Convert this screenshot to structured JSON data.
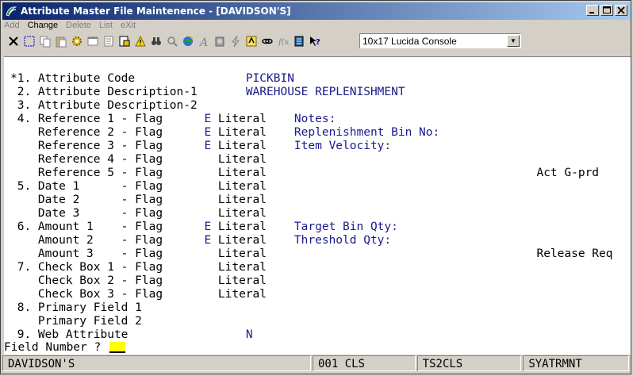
{
  "window": {
    "title": "Attribute Master File Maintenence - [DAVIDSON'S]",
    "minimize": "_",
    "maximize": "□",
    "close": "×"
  },
  "menu": {
    "items": [
      {
        "label": "Add",
        "enabled": false
      },
      {
        "label": "Change",
        "enabled": true
      },
      {
        "label": "Delete",
        "enabled": false
      },
      {
        "label": "List",
        "enabled": false
      },
      {
        "label": "eXit",
        "enabled": false
      }
    ]
  },
  "toolbar": {
    "font_selector_value": "10x17 Lucida Console",
    "icons": [
      "close-x-icon",
      "select-icon",
      "copy-icon",
      "paste-icon",
      "gear-icon",
      "window-icon",
      "list-icon",
      "print-preview-icon",
      "warning-icon",
      "binoculars-icon",
      "magnifier-icon",
      "globe-icon",
      "font-a-icon",
      "phone-icon",
      "lightning-icon",
      "calc-icon",
      "link-icon",
      "function-icon",
      "notes-icon",
      "help-pointer-icon"
    ]
  },
  "screen": {
    "lines": [
      {
        "left": "*1. Attribute Code",
        "right": "PICKBIN"
      },
      {
        "left": " 2. Attribute Description-1",
        "right": "WAREHOUSE REPLENISHMENT"
      },
      {
        "left": " 3. Attribute Description-2",
        "right": ""
      },
      {
        "left": " 4. Reference 1 - Flag",
        "flag": "E",
        "lit": "Literal",
        "note": "Notes:"
      },
      {
        "left": "    Reference 2 - Flag",
        "flag": "E",
        "lit": "Literal",
        "note": "Replenishment Bin No:"
      },
      {
        "left": "    Reference 3 - Flag",
        "flag": "E",
        "lit": "Literal",
        "note": "Item Velocity:"
      },
      {
        "left": "    Reference 4 - Flag",
        "flag": "",
        "lit": "Literal",
        "note": ""
      },
      {
        "left": "    Reference 5 - Flag",
        "flag": "",
        "lit": "Literal",
        "note": "",
        "far": "Act G-prd"
      },
      {
        "left": " 5. Date 1      - Flag",
        "flag": "",
        "lit": "Literal",
        "note": ""
      },
      {
        "left": "    Date 2      - Flag",
        "flag": "",
        "lit": "Literal",
        "note": ""
      },
      {
        "left": "    Date 3      - Flag",
        "flag": "",
        "lit": "Literal",
        "note": ""
      },
      {
        "left": " 6. Amount 1    - Flag",
        "flag": "E",
        "lit": "Literal",
        "note": "Target Bin Qty:"
      },
      {
        "left": "    Amount 2    - Flag",
        "flag": "E",
        "lit": "Literal",
        "note": "Threshold Qty:"
      },
      {
        "left": "    Amount 3    - Flag",
        "flag": "",
        "lit": "Literal",
        "note": "",
        "far": "Release Req"
      },
      {
        "left": " 7. Check Box 1 - Flag",
        "flag": "",
        "lit": "Literal",
        "note": ""
      },
      {
        "left": "    Check Box 2 - Flag",
        "flag": "",
        "lit": "Literal",
        "note": ""
      },
      {
        "left": "    Check Box 3 - Flag",
        "flag": "",
        "lit": "Literal",
        "note": ""
      },
      {
        "left": " 8. Primary Field 1",
        "right": ""
      },
      {
        "left": "    Primary Field 2",
        "right": ""
      },
      {
        "left": " 9. Web Attribute",
        "right": "N"
      }
    ],
    "prompt": "Field Number ?"
  },
  "status": {
    "company": "DAVIDSON'S",
    "terminal": "001 CLS",
    "session": "TS2CLS",
    "program": "SYATRMNT"
  },
  "colors": {
    "title_start": "#0a246a",
    "title_end": "#a6caf0",
    "data_text": "#1a1a8c",
    "cursor": "#ffff00"
  }
}
